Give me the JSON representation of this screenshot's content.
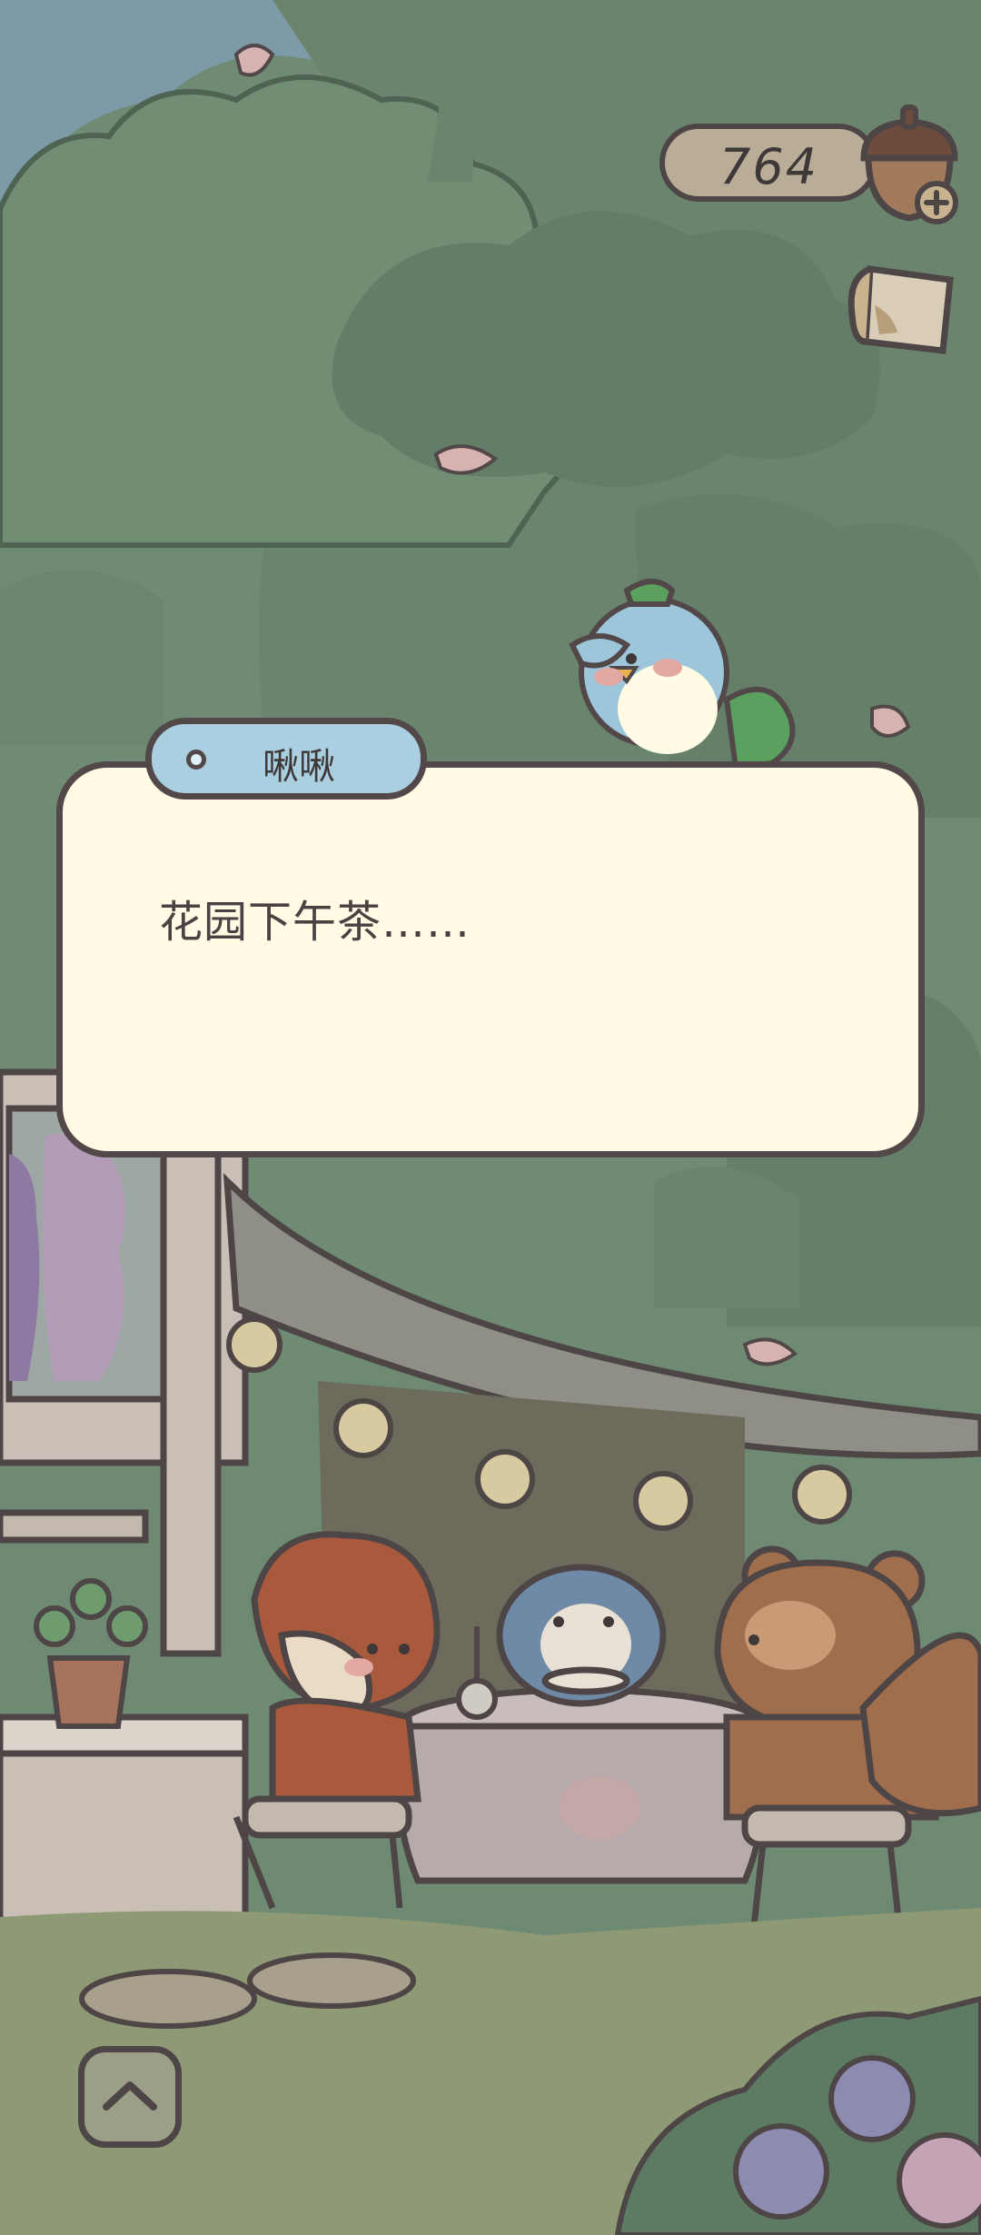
{
  "hud": {
    "acorn_count": "764"
  },
  "dialog": {
    "speaker": "啾啾",
    "text": "花园下午茶……"
  },
  "colors": {
    "sky": "#7d9aa8",
    "foliage": "#6f8a73",
    "dialog_bg": "#fffbe4",
    "name_tag_bg": "#a9cfe0",
    "outline": "#524849"
  },
  "icons": {
    "currency": "acorn-icon",
    "add": "plus-icon",
    "mail": "mail-icon",
    "expand": "chevron-up-icon"
  }
}
